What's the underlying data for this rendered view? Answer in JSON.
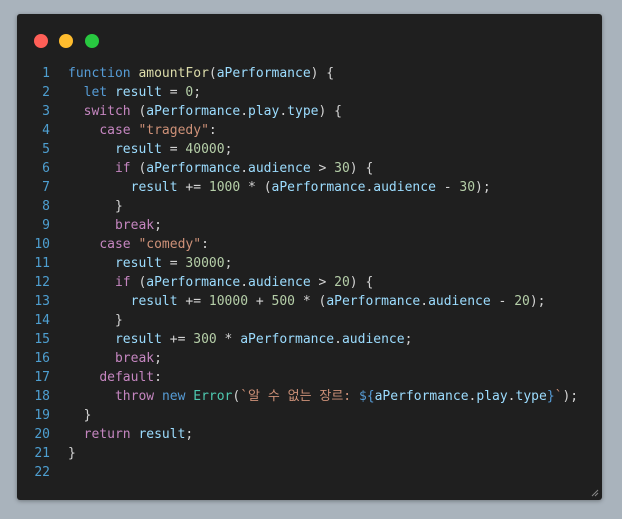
{
  "window": {
    "controls": [
      {
        "name": "close-dot-icon",
        "color": "#ff5f57"
      },
      {
        "name": "minimize-dot-icon",
        "color": "#febc2e"
      },
      {
        "name": "maximize-dot-icon",
        "color": "#28c840"
      }
    ]
  },
  "code": {
    "lines": [
      {
        "num": "1",
        "tokens": [
          {
            "t": "function",
            "c": "kw"
          },
          {
            "t": " "
          },
          {
            "t": "amountFor",
            "c": "fn"
          },
          {
            "t": "("
          },
          {
            "t": "aPerformance",
            "c": "var"
          },
          {
            "t": ") {"
          }
        ]
      },
      {
        "num": "2",
        "tokens": [
          {
            "t": "  "
          },
          {
            "t": "let",
            "c": "kw"
          },
          {
            "t": " "
          },
          {
            "t": "result",
            "c": "var"
          },
          {
            "t": " = "
          },
          {
            "t": "0",
            "c": "num"
          },
          {
            "t": ";"
          }
        ]
      },
      {
        "num": "3",
        "tokens": [
          {
            "t": "  "
          },
          {
            "t": "switch",
            "c": "ctl"
          },
          {
            "t": " ("
          },
          {
            "t": "aPerformance",
            "c": "var"
          },
          {
            "t": "."
          },
          {
            "t": "play",
            "c": "var"
          },
          {
            "t": "."
          },
          {
            "t": "type",
            "c": "var"
          },
          {
            "t": ") {"
          }
        ]
      },
      {
        "num": "4",
        "tokens": [
          {
            "t": "    "
          },
          {
            "t": "case",
            "c": "ctl"
          },
          {
            "t": " "
          },
          {
            "t": "\"tragedy\"",
            "c": "str"
          },
          {
            "t": ":"
          }
        ]
      },
      {
        "num": "5",
        "tokens": [
          {
            "t": "      "
          },
          {
            "t": "result",
            "c": "var"
          },
          {
            "t": " = "
          },
          {
            "t": "40000",
            "c": "num"
          },
          {
            "t": ";"
          }
        ]
      },
      {
        "num": "6",
        "tokens": [
          {
            "t": "      "
          },
          {
            "t": "if",
            "c": "ctl"
          },
          {
            "t": " ("
          },
          {
            "t": "aPerformance",
            "c": "var"
          },
          {
            "t": "."
          },
          {
            "t": "audience",
            "c": "var"
          },
          {
            "t": " > "
          },
          {
            "t": "30",
            "c": "num"
          },
          {
            "t": ") {"
          }
        ]
      },
      {
        "num": "7",
        "tokens": [
          {
            "t": "        "
          },
          {
            "t": "result",
            "c": "var"
          },
          {
            "t": " += "
          },
          {
            "t": "1000",
            "c": "num"
          },
          {
            "t": " * ("
          },
          {
            "t": "aPerformance",
            "c": "var"
          },
          {
            "t": "."
          },
          {
            "t": "audience",
            "c": "var"
          },
          {
            "t": " - "
          },
          {
            "t": "30",
            "c": "num"
          },
          {
            "t": ");"
          }
        ]
      },
      {
        "num": "8",
        "tokens": [
          {
            "t": "      }"
          }
        ]
      },
      {
        "num": "9",
        "tokens": [
          {
            "t": "      "
          },
          {
            "t": "break",
            "c": "ctl"
          },
          {
            "t": ";"
          }
        ]
      },
      {
        "num": "10",
        "tokens": [
          {
            "t": "    "
          },
          {
            "t": "case",
            "c": "ctl"
          },
          {
            "t": " "
          },
          {
            "t": "\"comedy\"",
            "c": "str"
          },
          {
            "t": ":"
          }
        ]
      },
      {
        "num": "11",
        "tokens": [
          {
            "t": "      "
          },
          {
            "t": "result",
            "c": "var"
          },
          {
            "t": " = "
          },
          {
            "t": "30000",
            "c": "num"
          },
          {
            "t": ";"
          }
        ]
      },
      {
        "num": "12",
        "tokens": [
          {
            "t": "      "
          },
          {
            "t": "if",
            "c": "ctl"
          },
          {
            "t": " ("
          },
          {
            "t": "aPerformance",
            "c": "var"
          },
          {
            "t": "."
          },
          {
            "t": "audience",
            "c": "var"
          },
          {
            "t": " > "
          },
          {
            "t": "20",
            "c": "num"
          },
          {
            "t": ") {"
          }
        ]
      },
      {
        "num": "13",
        "tokens": [
          {
            "t": "        "
          },
          {
            "t": "result",
            "c": "var"
          },
          {
            "t": " += "
          },
          {
            "t": "10000",
            "c": "num"
          },
          {
            "t": " + "
          },
          {
            "t": "500",
            "c": "num"
          },
          {
            "t": " * ("
          },
          {
            "t": "aPerformance",
            "c": "var"
          },
          {
            "t": "."
          },
          {
            "t": "audience",
            "c": "var"
          },
          {
            "t": " - "
          },
          {
            "t": "20",
            "c": "num"
          },
          {
            "t": ");"
          }
        ]
      },
      {
        "num": "14",
        "tokens": [
          {
            "t": "      }"
          }
        ]
      },
      {
        "num": "15",
        "tokens": [
          {
            "t": "      "
          },
          {
            "t": "result",
            "c": "var"
          },
          {
            "t": " += "
          },
          {
            "t": "300",
            "c": "num"
          },
          {
            "t": " * "
          },
          {
            "t": "aPerformance",
            "c": "var"
          },
          {
            "t": "."
          },
          {
            "t": "audience",
            "c": "var"
          },
          {
            "t": ";"
          }
        ]
      },
      {
        "num": "16",
        "tokens": [
          {
            "t": "      "
          },
          {
            "t": "break",
            "c": "ctl"
          },
          {
            "t": ";"
          }
        ]
      },
      {
        "num": "17",
        "tokens": [
          {
            "t": "    "
          },
          {
            "t": "default",
            "c": "ctl"
          },
          {
            "t": ":"
          }
        ]
      },
      {
        "num": "18",
        "tokens": [
          {
            "t": "      "
          },
          {
            "t": "throw",
            "c": "ctl"
          },
          {
            "t": " "
          },
          {
            "t": "new",
            "c": "kw"
          },
          {
            "t": " "
          },
          {
            "t": "Error",
            "c": "cls"
          },
          {
            "t": "("
          },
          {
            "t": "`알 수 없는 장르: ",
            "c": "str"
          },
          {
            "t": "${",
            "c": "tpl"
          },
          {
            "t": "aPerformance",
            "c": "var"
          },
          {
            "t": "."
          },
          {
            "t": "play",
            "c": "var"
          },
          {
            "t": "."
          },
          {
            "t": "type",
            "c": "var"
          },
          {
            "t": "}",
            "c": "tpl"
          },
          {
            "t": "`",
            "c": "str"
          },
          {
            "t": ");"
          }
        ]
      },
      {
        "num": "19",
        "tokens": [
          {
            "t": "  }"
          }
        ]
      },
      {
        "num": "20",
        "tokens": [
          {
            "t": "  "
          },
          {
            "t": "return",
            "c": "ctl"
          },
          {
            "t": " "
          },
          {
            "t": "result",
            "c": "var"
          },
          {
            "t": ";"
          }
        ]
      },
      {
        "num": "21",
        "tokens": [
          {
            "t": "}"
          }
        ]
      },
      {
        "num": "22",
        "tokens": []
      }
    ]
  }
}
